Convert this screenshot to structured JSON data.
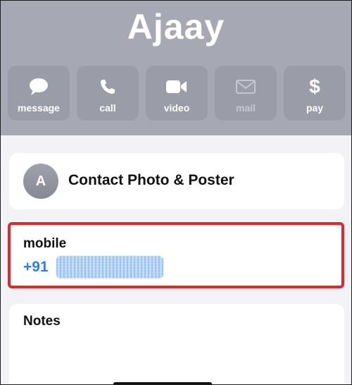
{
  "contact": {
    "name": "Ajaay"
  },
  "actions": [
    {
      "label": "message",
      "icon": "message-bubble-icon",
      "enabled": true
    },
    {
      "label": "call",
      "icon": "phone-icon",
      "enabled": true
    },
    {
      "label": "video",
      "icon": "video-camera-icon",
      "enabled": true
    },
    {
      "label": "mail",
      "icon": "envelope-icon",
      "enabled": false
    },
    {
      "label": "pay",
      "icon": "dollar-icon",
      "enabled": true
    }
  ],
  "photo_card": {
    "avatar_initial": "A",
    "label": "Contact Photo & Poster"
  },
  "mobile": {
    "label": "mobile",
    "number_prefix": "+91"
  },
  "notes": {
    "label": "Notes"
  },
  "colors": {
    "header_bg": "#a6a8b4",
    "action_bg": "#9a9ca8",
    "link_blue": "#2f7fe0",
    "highlight_red": "#e3262e"
  }
}
